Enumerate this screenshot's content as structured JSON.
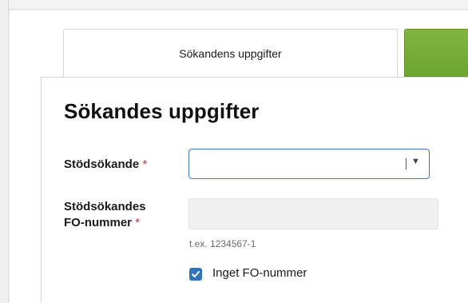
{
  "tabs": {
    "active_label": "Sökandens uppgifter"
  },
  "form": {
    "title": "Sökandes uppgifter",
    "required_marker": "*",
    "applicant": {
      "label": "Stödsökande",
      "value": ""
    },
    "business_id": {
      "label_line1": "Stödsökandes",
      "label_line2": "FO-nummer",
      "value": "",
      "hint": "t.ex. 1234567-1"
    },
    "no_business_id": {
      "label": "Inget FO-nummer",
      "checked": true
    }
  },
  "colors": {
    "accent_blue": "#2f74c0",
    "tab_green": "#75ab35",
    "required_red": "#d0312d"
  },
  "icons": {
    "dropdown": "chevron-down-icon",
    "checkbox": "checkmark-icon"
  }
}
